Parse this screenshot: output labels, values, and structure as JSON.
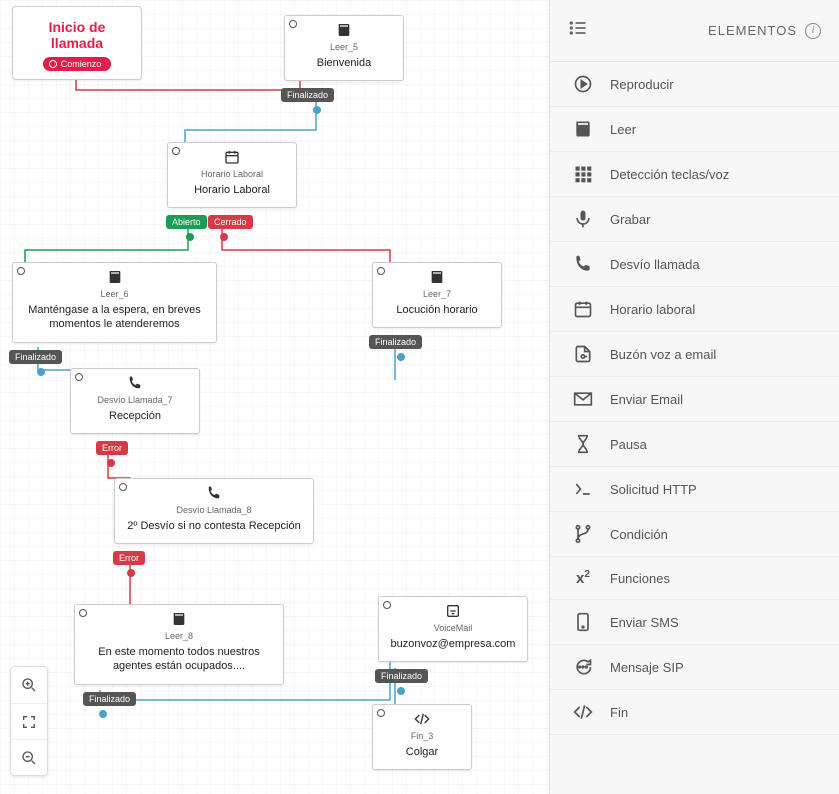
{
  "start": {
    "title": "Inicio de llamada",
    "pill": "Comienzo"
  },
  "nodes": {
    "leer5": {
      "type": "Leer_5",
      "title": "Bienvenida",
      "out": "Finalizado"
    },
    "horario": {
      "type": "Horario Laboral",
      "title": "Horario Laboral",
      "out_open": "Abierto",
      "out_closed": "Cerrado"
    },
    "leer6": {
      "type": "Leer_6",
      "title": "Manténgase a la espera, en breves momentos le atenderemos",
      "out": "Finalizado"
    },
    "leer7": {
      "type": "Leer_7",
      "title": "Locución horario",
      "out": "Finalizado"
    },
    "desv7": {
      "type": "Desvío Llamada_7",
      "title": "Recepción",
      "out": "Error"
    },
    "desv8": {
      "type": "Desvío Llamada_8",
      "title": "2º Desvío si no contesta Recepción",
      "out": "Error"
    },
    "leer8": {
      "type": "Leer_8",
      "title": "En este momento todos nuestros agentes están ocupados....",
      "out": "Finalizado"
    },
    "vm": {
      "type": "VoiceMail",
      "title": "buzonvoz@empresa.com",
      "out": "Finalizado"
    },
    "fin": {
      "type": "Fin_3",
      "title": "Colgar"
    }
  },
  "sidebar": {
    "title": "ELEMENTOS",
    "items": [
      "Reproducir",
      "Leer",
      "Detección teclas/voz",
      "Grabar",
      "Desvío llamada",
      "Horario laboral",
      "Buzón voz a email",
      "Enviar Email",
      "Pausa",
      "Solicitud HTTP",
      "Condición",
      "Funciones",
      "Enviar SMS",
      "Mensaje SIP",
      "Fin"
    ]
  }
}
